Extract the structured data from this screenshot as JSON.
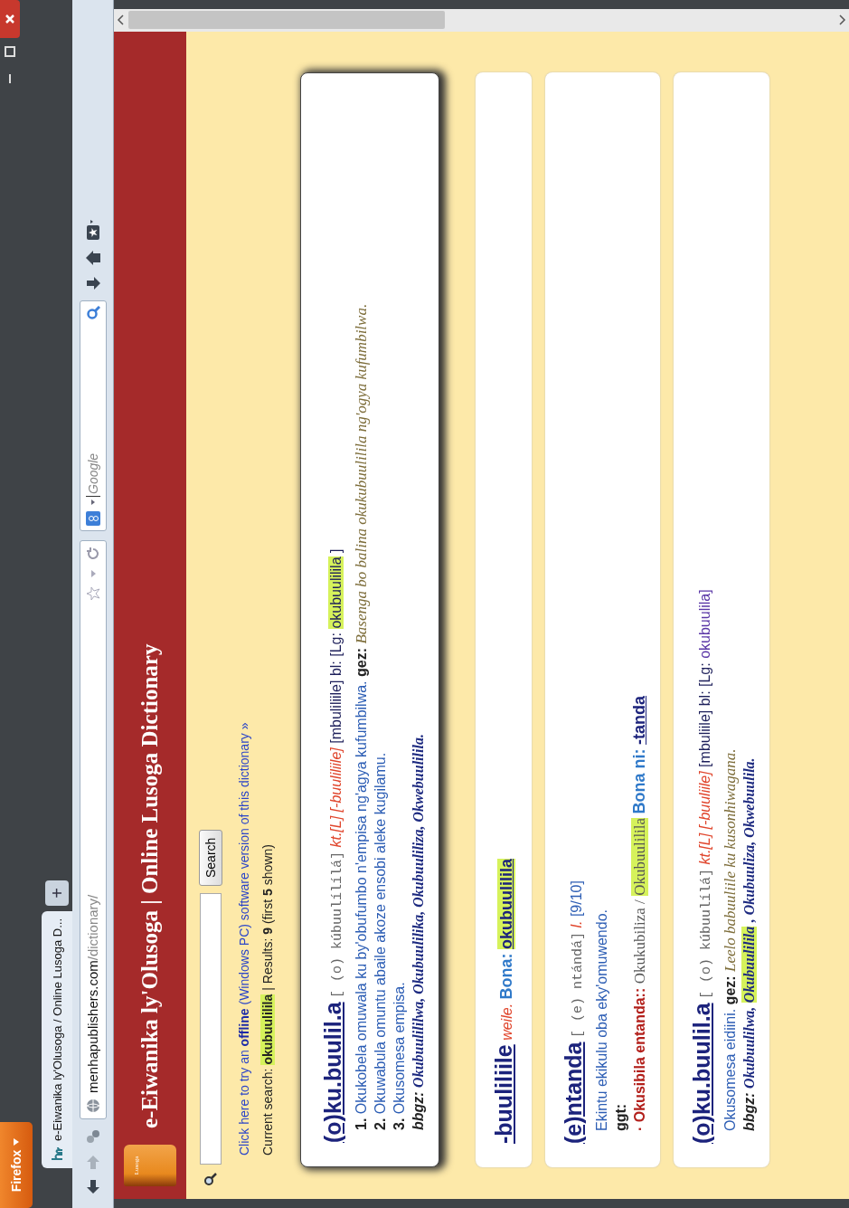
{
  "window": {
    "button": "Firefox",
    "tab_title": "e-Eiwanika ly'Olusoga / Online Lusoga D...",
    "tab_add": "+",
    "url_host": "menhapublishers.com",
    "url_path": "/dictionary/",
    "search_placeholder": "Google"
  },
  "header": {
    "logo_text": "Lusoga",
    "title": "e-Eiwanika ly'Olusoga | Online Lusoga Dictionary"
  },
  "search": {
    "button": "Search"
  },
  "offline_notice": "Click here to try an **offline** (Windows PC) software version of this dictionary »",
  "current_search": {
    "label": "Current search:",
    "term": "okubuulilila",
    "results": "| Results: **9** (first **5** shown)"
  },
  "entries": [
    {
      "selected": true,
      "lines": [
        {
          "kind": "head",
          "segs": [
            {
              "kind": "headword",
              "text": "(o)ku.buulil.a"
            },
            {
              "kind": "pron",
              "text": "[ (o) kúbuulílílá]"
            },
            {
              "kind": "gram",
              "text": "kt.[L]"
            },
            {
              "kind": "gram",
              "text": "[-buuliliile]"
            },
            {
              "kind": "text",
              "text": "[mbuliliile] bl: [Lg:"
            },
            {
              "kind": "hl",
              "text": "okubuulilila"
            },
            {
              "kind": "text",
              "text": "]"
            }
          ]
        },
        {
          "kind": "body",
          "segs": [
            {
              "kind": "num",
              "text": "1."
            },
            {
              "kind": "def",
              "text": "Okukobela omuwala ku by'obufumbo n'empisa ng'agya kufumbilwa."
            },
            {
              "kind": "label",
              "text": "gez:"
            },
            {
              "kind": "example",
              "text": "Basenga bo balina okukubuulilila ng'ogya kufumbilwa."
            }
          ]
        },
        {
          "kind": "body",
          "segs": [
            {
              "kind": "num",
              "text": "2."
            },
            {
              "kind": "def",
              "text": "Okuwabula omuntu abaile akoze ensobi aleke kugilamu."
            }
          ]
        },
        {
          "kind": "body",
          "segs": [
            {
              "kind": "num",
              "text": "3."
            },
            {
              "kind": "def",
              "text": "Okusomesa empisa."
            }
          ]
        },
        {
          "kind": "body",
          "segs": [
            {
              "kind": "label_italic",
              "text": "bbgz:"
            },
            {
              "kind": "deriv",
              "text": "Okubuulililwa, Okubuulilika, Okubuuliliza, Okwebuulilila."
            }
          ]
        }
      ]
    },
    {
      "selected": false,
      "lines": [
        {
          "kind": "head",
          "segs": [
            {
              "kind": "headword",
              "text": "-buuliliile"
            },
            {
              "kind": "gram",
              "text": "weile."
            },
            {
              "kind": "xref",
              "text": "Bona:"
            },
            {
              "kind": "hl_link",
              "text": "okubuulilila"
            }
          ]
        }
      ]
    },
    {
      "selected": false,
      "lines": [
        {
          "kind": "head",
          "segs": [
            {
              "kind": "headword",
              "text": "(e)ntanda"
            },
            {
              "kind": "pron",
              "text": "[ (e) ntándá]"
            },
            {
              "kind": "gram",
              "text": "l."
            },
            {
              "kind": "def",
              "text": "[9/10]"
            }
          ]
        },
        {
          "kind": "body",
          "segs": [
            {
              "kind": "def",
              "text": "Ekintu ekikulu oba eky'omuwendo."
            }
          ]
        },
        {
          "kind": "body",
          "segs": [
            {
              "kind": "label",
              "text": "ggt:"
            }
          ]
        },
        {
          "kind": "body",
          "segs": [
            {
              "kind": "term",
              "text": "· Okusibila entanda::"
            },
            {
              "kind": "serif",
              "text": "Okukubiliza /"
            },
            {
              "kind": "hl_serif",
              "text": "Okubuulilila"
            },
            {
              "kind": "xref",
              "text": "Bona ni:"
            },
            {
              "kind": "link",
              "text": "-tanda"
            }
          ]
        }
      ]
    },
    {
      "selected": false,
      "lines": [
        {
          "kind": "head",
          "segs": [
            {
              "kind": "headword",
              "text": "(o)ku.buulil.a"
            },
            {
              "kind": "pron",
              "text": "[ (o) kúbuulílá]"
            },
            {
              "kind": "gram",
              "text": "kt.[L]"
            },
            {
              "kind": "gram",
              "text": "[-buuliile]"
            },
            {
              "kind": "text",
              "text": "[mbuliile] bl: [Lg:"
            },
            {
              "kind": "lg",
              "text": "okubuulila]"
            }
          ]
        },
        {
          "kind": "body",
          "segs": [
            {
              "kind": "def",
              "text": "Okusomesa eidiini."
            },
            {
              "kind": "label",
              "text": "gez:"
            },
            {
              "kind": "example",
              "text": "Leelo babuuliile ku kusonhiwagana."
            }
          ]
        },
        {
          "kind": "body",
          "segs": [
            {
              "kind": "label_italic",
              "text": "bbgz:"
            },
            {
              "kind": "deriv",
              "text": "Okubuulilwa,"
            },
            {
              "kind": "hl_deriv",
              "text": "Okubuulilila"
            },
            {
              "kind": "deriv",
              "text": ", Okubuuliza, Okwebuulila."
            }
          ]
        }
      ]
    }
  ]
}
